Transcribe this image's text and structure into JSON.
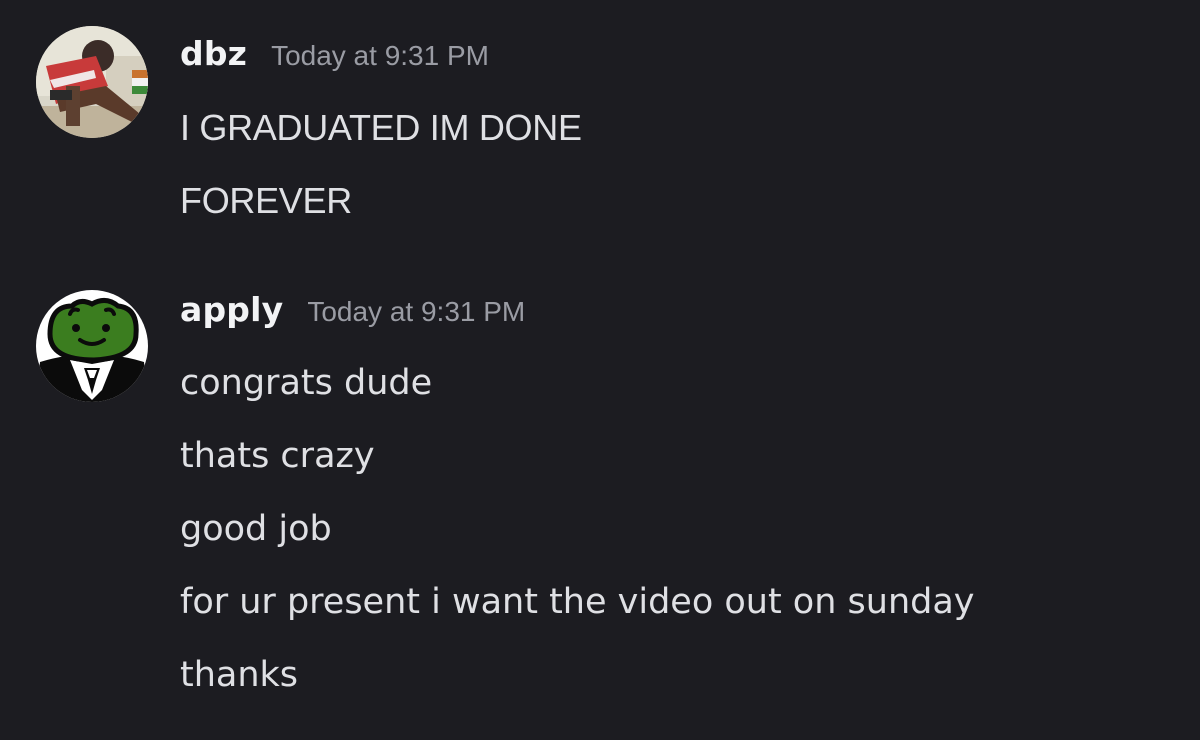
{
  "messages": [
    {
      "username": "dbz",
      "timestamp": "Today at 9:31 PM",
      "avatar_icon": "user-photo-avatar",
      "lines": [
        "I GRADUATED IM DONE",
        "FOREVER"
      ]
    },
    {
      "username": "apply",
      "timestamp": "Today at 9:31 PM",
      "avatar_icon": "frog-face-avatar",
      "lines": [
        "congrats dude",
        "thats crazy",
        "good job",
        "for ur present i want the video out on sunday",
        "thanks"
      ]
    }
  ],
  "colors": {
    "background": "#1c1c21",
    "username": "#f2f3f5",
    "timestamp": "#9a9ca4",
    "message_text": "#dfe0e4",
    "frog_green": "#3b7d1f"
  }
}
